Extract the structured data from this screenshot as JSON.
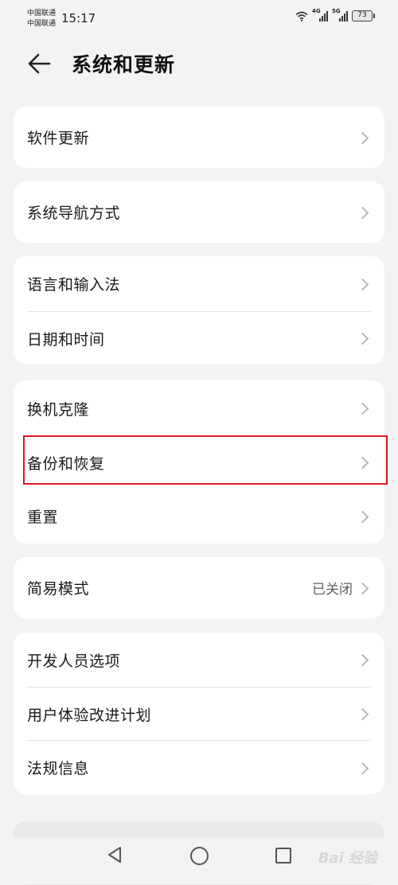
{
  "status_bar": {
    "carrier_1": "中国联通",
    "carrier_2": "中国联通",
    "time": "15:17",
    "network_1": "4G",
    "network_2": "5G",
    "battery": "73"
  },
  "header": {
    "title": "系统和更新",
    "back_icon": "arrow-left-icon"
  },
  "sections": [
    {
      "items": [
        {
          "label": "软件更新"
        }
      ]
    },
    {
      "items": [
        {
          "label": "系统导航方式"
        }
      ]
    },
    {
      "items": [
        {
          "label": "语言和输入法"
        },
        {
          "label": "日期和时间"
        }
      ]
    },
    {
      "items": [
        {
          "label": "换机克隆"
        },
        {
          "label": "备份和恢复"
        },
        {
          "label": "重置"
        }
      ]
    },
    {
      "items": [
        {
          "label": "简易模式",
          "value": "已关闭"
        }
      ]
    },
    {
      "items": [
        {
          "label": "开发人员选项"
        },
        {
          "label": "用户体验改进计划"
        },
        {
          "label": "法规信息"
        }
      ]
    }
  ],
  "highlight": {
    "color": "#e0161f",
    "item": "备份和恢复"
  },
  "nav_bar": {
    "icons": [
      "triangle-back-icon",
      "circle-home-icon",
      "square-recents-icon"
    ]
  },
  "watermark": "Bai 经验"
}
